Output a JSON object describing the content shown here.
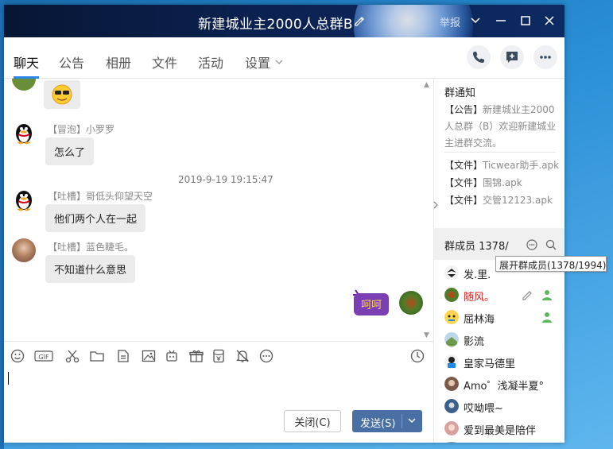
{
  "window": {
    "title": "新建城业主2000人总群B",
    "report_label": "举报"
  },
  "tabs": [
    {
      "label": "聊天",
      "active": true
    },
    {
      "label": "公告",
      "active": false
    },
    {
      "label": "相册",
      "active": false
    },
    {
      "label": "文件",
      "active": false
    },
    {
      "label": "活动",
      "active": false
    },
    {
      "label": "设置",
      "active": false
    }
  ],
  "chat": {
    "messages": [
      {
        "sender": "【冒泡】小罗罗",
        "text": "怎么了"
      },
      {
        "sender": "【吐槽】哥低头仰望天空",
        "text": "他们两个人在一起"
      },
      {
        "sender": "【吐槽】蓝色睫毛。",
        "text": "不知道什么意思"
      }
    ],
    "timestamp": "2019-9-19 19:15:47",
    "sticker_text": "呵呵"
  },
  "toolbar": {
    "gif_label": "GIF"
  },
  "buttons": {
    "close_label": "关闭(C)",
    "send_label": "发送(S)"
  },
  "notice": {
    "title": "群通知",
    "announcement_tag": "【公告】",
    "announcement_text": "新建城业主2000人总群（B）欢迎新建城业主进群交流。",
    "files": [
      {
        "tag": "【文件】",
        "name": "Ticwear助手.apk"
      },
      {
        "tag": "【文件】",
        "name": "围锦.apk"
      },
      {
        "tag": "【文件】",
        "name": "交管12123.apk"
      }
    ]
  },
  "members": {
    "title": "群成员 1378/",
    "tooltip": "展开群成员(1378/1994)",
    "list": [
      {
        "name": "发.里.",
        "highlight": false
      },
      {
        "name": "随风。",
        "highlight": true
      },
      {
        "name": "屈林海",
        "highlight": false
      },
      {
        "name": "影流",
        "highlight": false
      },
      {
        "name": "皇家马德里",
        "highlight": false
      },
      {
        "name": "Amo゜浅凝半夏°",
        "highlight": false
      },
      {
        "name": "哎呦喂~",
        "highlight": false
      },
      {
        "name": "爱到最美是陪伴",
        "highlight": false
      }
    ]
  },
  "colors": {
    "accent": "#2a86e8",
    "send_button": "#4a6fa5",
    "titlebar": "#0b2150",
    "highlight_name": "#e02020"
  }
}
